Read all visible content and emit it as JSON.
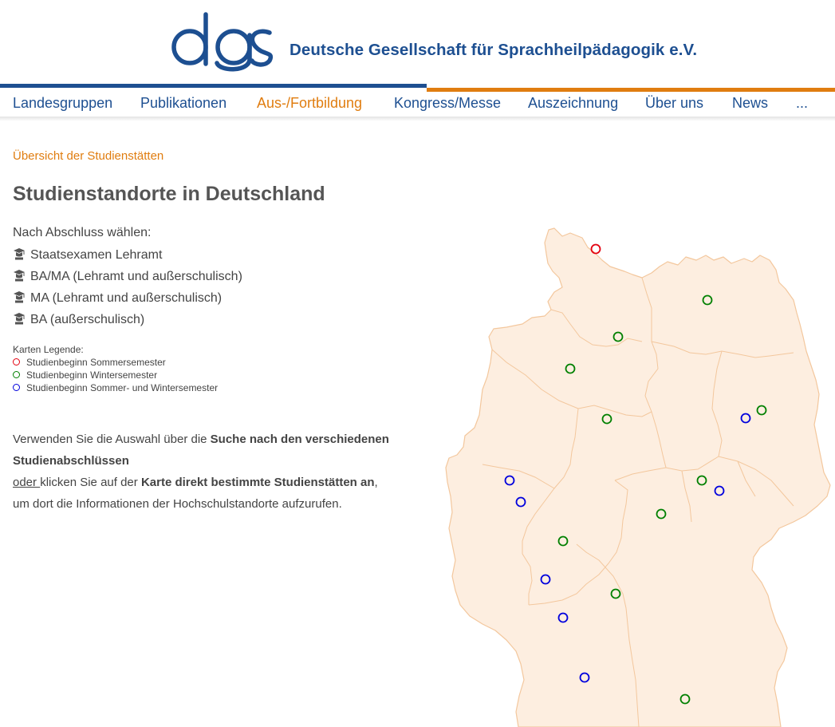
{
  "header": {
    "logo_text": "dgs",
    "org_name": "Deutsche Gesellschaft für Sprachheilpädagogik e.V."
  },
  "nav": {
    "items": [
      {
        "label": "Landesgruppen"
      },
      {
        "label": "Publikationen"
      },
      {
        "label": "Aus-/Fortbildung",
        "active": true
      },
      {
        "label": "Kongress/Messe"
      },
      {
        "label": "Auszeichnung"
      },
      {
        "label": "Über uns"
      },
      {
        "label": "News"
      },
      {
        "label": "..."
      }
    ]
  },
  "breadcrumb": "Übersicht der Studienstätten",
  "page_title": "Studienstandorte in Deutschland",
  "choose": {
    "label": "Nach Abschluss wählen:",
    "options": [
      {
        "label": "Staatsexamen Lehramt",
        "icon": "graduation-cap-icon"
      },
      {
        "label": "BA/MA (Lehramt und außerschulisch)",
        "icon": "graduation-cap-icon"
      },
      {
        "label": "MA (Lehramt und außerschulisch)",
        "icon": "graduation-cap-icon"
      },
      {
        "label": "BA (außerschulisch)",
        "icon": "graduation-cap-icon"
      }
    ]
  },
  "legend": {
    "title": "Karten Legende:",
    "items": [
      {
        "label": "Studienbeginn Sommersemester",
        "color": "#e3000f"
      },
      {
        "label": "Studienbeginn Wintersemester",
        "color": "#008000"
      },
      {
        "label": "Studienbeginn Sommer- und Wintersemester",
        "color": "#0000dd"
      }
    ]
  },
  "info": {
    "part1": "Verwenden Sie die Auswahl über die ",
    "bold1": "Suche nach den verschiedenen Studienabschlüssen",
    "oder": "oder ",
    "part2": "klicken Sie auf der ",
    "bold2": "Karte direkt bestimmte Studienstätten an",
    "part3": ",",
    "part4": "um dort die Informationen der Hochschulstandorte aufzurufen."
  },
  "colors": {
    "brand_blue": "#1d4f91",
    "accent_orange": "#e07d10",
    "map_fill": "#fdeee0",
    "map_border": "#f3c79d"
  },
  "map": {
    "markers": [
      {
        "type": "summer"
      },
      {
        "type": "winter"
      },
      {
        "type": "winter"
      },
      {
        "type": "winter"
      },
      {
        "type": "winter"
      },
      {
        "type": "winter"
      },
      {
        "type": "both"
      },
      {
        "type": "both"
      },
      {
        "type": "both"
      },
      {
        "type": "winter"
      },
      {
        "type": "both"
      },
      {
        "type": "winter"
      },
      {
        "type": "winter"
      },
      {
        "type": "both"
      },
      {
        "type": "winter"
      },
      {
        "type": "both"
      },
      {
        "type": "both"
      },
      {
        "type": "winter"
      }
    ]
  }
}
